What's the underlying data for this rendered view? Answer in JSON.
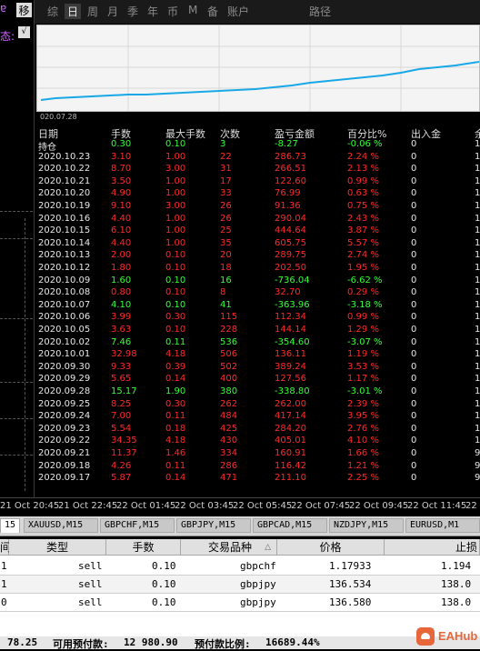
{
  "left_panel": {
    "items": [
      "ɐ",
      "态:"
    ],
    "checkbox_value": "√",
    "highlight": "移"
  },
  "tabs": [
    {
      "label": "综",
      "active": false
    },
    {
      "label": "日",
      "active": true
    },
    {
      "label": "周",
      "active": false
    },
    {
      "label": "月",
      "active": false
    },
    {
      "label": "季",
      "active": false
    },
    {
      "label": "年",
      "active": false
    },
    {
      "label": "币",
      "active": false
    },
    {
      "label": "M",
      "active": false
    },
    {
      "label": "备",
      "active": false
    },
    {
      "label": "账户",
      "active": false
    },
    {
      "label": "路径",
      "active": false
    }
  ],
  "chart": {
    "date_label": "020.07.28",
    "line_color": "#19a8e6"
  },
  "table": {
    "headers": [
      "日期",
      "手数",
      "最大手数",
      "次数",
      "盈亏金额",
      "百分比%",
      "出入金",
      "余"
    ],
    "rows": [
      {
        "date": "持仓",
        "lots": "0.30",
        "max_lots": "0.10",
        "count": "3",
        "pnl": "-8.27",
        "pct": "-0.06 %",
        "inout": "0",
        "bal": "1",
        "color": "green"
      },
      {
        "date": "2020.10.23",
        "lots": "3.10",
        "max_lots": "1.00",
        "count": "22",
        "pnl": "286.73",
        "pct": "2.24 %",
        "inout": "0",
        "bal": "1",
        "color": "red"
      },
      {
        "date": "2020.10.22",
        "lots": "8.70",
        "max_lots": "3.00",
        "count": "31",
        "pnl": "266.51",
        "pct": "2.13 %",
        "inout": "0",
        "bal": "1",
        "color": "red"
      },
      {
        "date": "2020.10.21",
        "lots": "3.50",
        "max_lots": "1.00",
        "count": "17",
        "pnl": "122.60",
        "pct": "0.99 %",
        "inout": "0",
        "bal": "1",
        "color": "red"
      },
      {
        "date": "2020.10.20",
        "lots": "4.90",
        "max_lots": "1.00",
        "count": "33",
        "pnl": "76.99",
        "pct": "0.63 %",
        "inout": "0",
        "bal": "1",
        "color": "red"
      },
      {
        "date": "2020.10.19",
        "lots": "9.10",
        "max_lots": "3.00",
        "count": "26",
        "pnl": "91.36",
        "pct": "0.75 %",
        "inout": "0",
        "bal": "1",
        "color": "red"
      },
      {
        "date": "2020.10.16",
        "lots": "4.40",
        "max_lots": "1.00",
        "count": "26",
        "pnl": "290.04",
        "pct": "2.43 %",
        "inout": "0",
        "bal": "1",
        "color": "red"
      },
      {
        "date": "2020.10.15",
        "lots": "6.10",
        "max_lots": "1.00",
        "count": "25",
        "pnl": "444.64",
        "pct": "3.87 %",
        "inout": "0",
        "bal": "1",
        "color": "red"
      },
      {
        "date": "2020.10.14",
        "lots": "4.40",
        "max_lots": "1.00",
        "count": "35",
        "pnl": "605.75",
        "pct": "5.57 %",
        "inout": "0",
        "bal": "1",
        "color": "red"
      },
      {
        "date": "2020.10.13",
        "lots": "2.00",
        "max_lots": "0.10",
        "count": "20",
        "pnl": "289.75",
        "pct": "2.74 %",
        "inout": "0",
        "bal": "1",
        "color": "red"
      },
      {
        "date": "2020.10.12",
        "lots": "1.80",
        "max_lots": "0.10",
        "count": "18",
        "pnl": "202.50",
        "pct": "1.95 %",
        "inout": "0",
        "bal": "1",
        "color": "red"
      },
      {
        "date": "2020.10.09",
        "lots": "1.60",
        "max_lots": "0.10",
        "count": "16",
        "pnl": "-736.04",
        "pct": "-6.62 %",
        "inout": "0",
        "bal": "1",
        "color": "green"
      },
      {
        "date": "2020.10.08",
        "lots": "0.80",
        "max_lots": "0.10",
        "count": "8",
        "pnl": "32.70",
        "pct": "0.29 %",
        "inout": "0",
        "bal": "1",
        "color": "red"
      },
      {
        "date": "2020.10.07",
        "lots": "4.10",
        "max_lots": "0.10",
        "count": "41",
        "pnl": "-363.96",
        "pct": "-3.18 %",
        "inout": "0",
        "bal": "1",
        "color": "green"
      },
      {
        "date": "2020.10.06",
        "lots": "3.99",
        "max_lots": "0.30",
        "count": "115",
        "pnl": "112.34",
        "pct": "0.99 %",
        "inout": "0",
        "bal": "1",
        "color": "red"
      },
      {
        "date": "2020.10.05",
        "lots": "3.63",
        "max_lots": "0.10",
        "count": "228",
        "pnl": "144.14",
        "pct": "1.29 %",
        "inout": "0",
        "bal": "1",
        "color": "red"
      },
      {
        "date": "2020.10.02",
        "lots": "7.46",
        "max_lots": "0.11",
        "count": "536",
        "pnl": "-354.60",
        "pct": "-3.07 %",
        "inout": "0",
        "bal": "1",
        "color": "green"
      },
      {
        "date": "2020.10.01",
        "lots": "32.98",
        "max_lots": "4.18",
        "count": "506",
        "pnl": "136.11",
        "pct": "1.19 %",
        "inout": "0",
        "bal": "1",
        "color": "red"
      },
      {
        "date": "2020.09.30",
        "lots": "9.33",
        "max_lots": "0.39",
        "count": "502",
        "pnl": "389.24",
        "pct": "3.53 %",
        "inout": "0",
        "bal": "1",
        "color": "red"
      },
      {
        "date": "2020.09.29",
        "lots": "5.65",
        "max_lots": "0.14",
        "count": "400",
        "pnl": "127.56",
        "pct": "1.17 %",
        "inout": "0",
        "bal": "1",
        "color": "red"
      },
      {
        "date": "2020.09.28",
        "lots": "15.17",
        "max_lots": "1.90",
        "count": "380",
        "pnl": "-338.80",
        "pct": "-3.01 %",
        "inout": "0",
        "bal": "1",
        "color": "green"
      },
      {
        "date": "2020.09.25",
        "lots": "8.25",
        "max_lots": "0.30",
        "count": "262",
        "pnl": "262.00",
        "pct": "2.39 %",
        "inout": "0",
        "bal": "1",
        "color": "red"
      },
      {
        "date": "2020.09.24",
        "lots": "7.00",
        "max_lots": "0.11",
        "count": "484",
        "pnl": "417.14",
        "pct": "3.95 %",
        "inout": "0",
        "bal": "1",
        "color": "red"
      },
      {
        "date": "2020.09.23",
        "lots": "5.54",
        "max_lots": "0.18",
        "count": "425",
        "pnl": "284.20",
        "pct": "2.76 %",
        "inout": "0",
        "bal": "1",
        "color": "red"
      },
      {
        "date": "2020.09.22",
        "lots": "34.35",
        "max_lots": "4.18",
        "count": "430",
        "pnl": "405.01",
        "pct": "4.10 %",
        "inout": "0",
        "bal": "1",
        "color": "red"
      },
      {
        "date": "2020.09.21",
        "lots": "11.37",
        "max_lots": "1.46",
        "count": "334",
        "pnl": "160.91",
        "pct": "1.66 %",
        "inout": "0",
        "bal": "9",
        "color": "red"
      },
      {
        "date": "2020.09.18",
        "lots": "4.26",
        "max_lots": "0.11",
        "count": "286",
        "pnl": "116.42",
        "pct": "1.21 %",
        "inout": "0",
        "bal": "9",
        "color": "red"
      },
      {
        "date": "2020.09.17",
        "lots": "5.87",
        "max_lots": "0.14",
        "count": "471",
        "pnl": "211.10",
        "pct": "2.25 %",
        "inout": "0",
        "bal": "9",
        "color": "red"
      }
    ]
  },
  "time_axis": [
    "21 Oct 20:45",
    "21 Oct 22:45",
    "22 Oct 01:45",
    "22 Oct 03:45",
    "22 Oct 05:45",
    "22 Oct 07:45",
    "22 Oct 09:45",
    "22 Oct 11:45",
    "22 Oc"
  ],
  "symbol_tabs": [
    {
      "label": "15",
      "active": true
    },
    {
      "label": "XAUUSD,M15",
      "active": false
    },
    {
      "label": "GBPCHF,M15",
      "active": false
    },
    {
      "label": "GBPJPY,M15",
      "active": false
    },
    {
      "label": "GBPCAD,M15",
      "active": false
    },
    {
      "label": "NZDJPY,M15",
      "active": false
    },
    {
      "label": "EURUSD,M1",
      "active": false
    }
  ],
  "orders": {
    "headers": [
      "间",
      "类型",
      "手数",
      "交易品种",
      "价格",
      "止损"
    ],
    "sort_indicator": "△",
    "rows": [
      {
        "id": "1",
        "type": "sell",
        "lots": "0.10",
        "symbol": "gbpchf",
        "price": "1.17933",
        "sl": "1.194"
      },
      {
        "id": "1",
        "type": "sell",
        "lots": "0.10",
        "symbol": "gbpjpy",
        "price": "136.534",
        "sl": "138.0"
      },
      {
        "id": "0",
        "type": "sell",
        "lots": "0.10",
        "symbol": "gbpjpy",
        "price": "136.580",
        "sl": "138.0"
      }
    ]
  },
  "status_bar": {
    "value1": "78.25",
    "label2": "可用预付款:",
    "value2": "12 980.90",
    "label3": "预付款比例:",
    "value3": "16689.44%"
  },
  "logo": {
    "text": "EAHub",
    "brand_color": "#e8673a"
  }
}
